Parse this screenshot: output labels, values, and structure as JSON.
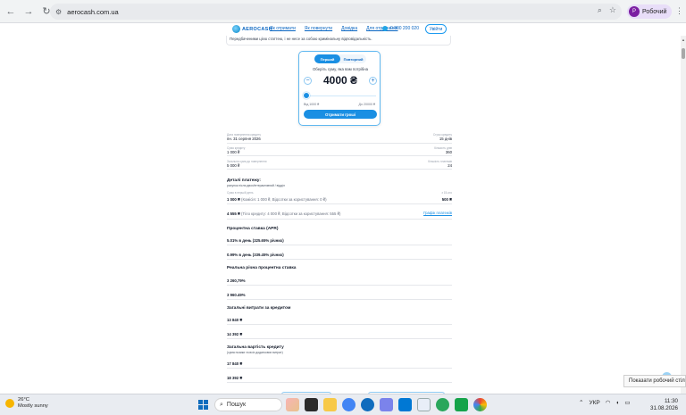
{
  "browser": {
    "url": "aerocash.com.ua",
    "profile_name": "Робочий",
    "profile_initial": "Р"
  },
  "site": {
    "logo_text": "AEROCASH",
    "nav": [
      "Як отримати",
      "Як повернути",
      "Довідка",
      "Для отримання"
    ],
    "phone": "0 800 200 020",
    "login_label": "Увійти"
  },
  "warning_text": "Передбаченими цією статтею, і не несе за собою кримінальну відповідальність.",
  "calculator": {
    "tab_active": "Перший",
    "tab_inactive": "Повторний",
    "prompt": "Оберіть суму, яка вам потрібна",
    "amount": "4000 ₴",
    "minus": "−",
    "plus": "+",
    "slider_fraction": 0.03,
    "range_min": "Від 1000 ₴",
    "range_max": "До 20000 ₴",
    "cta": "Отримати гроші"
  },
  "details": {
    "due_label": "Дата повернення кредиту",
    "due_value": "пн. 31 серпня 2026",
    "term_label": "Строк кредиту",
    "term_value": "15 днів",
    "amount_label": "Сума кредиту",
    "amount_value": "1 000 ₴",
    "days_label": "Кількість днів",
    "days_value": "360",
    "total_label": "Загальна сума до повернення",
    "total_value": "5 000 ₴",
    "count_label": "Кількість платежів",
    "count_value": "24"
  },
  "payment": {
    "title": "Деталі платежу:",
    "subtitle": "рахунок після двох/інтерактивний / відділ",
    "row1_label": "Сума в першій день",
    "row1_value_bold": "1 000 ₴",
    "row1_value_rest": "(Комісія: 1 000 ₴, Відсотки за користування: 0 ₴)",
    "row1_right_label": "з 15-ого",
    "row1_right_value": "500 ₴",
    "row2_value_bold": "4 555 ₴",
    "row2_value_rest": "(Тіло кредиту: 4 000 ₴, Відсотки за користування: 555 ₴)",
    "row2_link": "Графік платежів"
  },
  "rates": {
    "apr_title": "Процентна ставка (APR)",
    "apr_value1": "5.01% в день (325.65% річних)",
    "apr_value2": "0.99% в день (339.45% річних)",
    "real_title": "Реальна річна процентна ставка",
    "real_value1": "3 260,79%",
    "real_value2": "3 960.49%"
  },
  "costs": {
    "title": "Загальні витрати за кредитом",
    "value1": "13 840 ₴",
    "value2": "14 392 ₴"
  },
  "total_cost": {
    "title": "Загальна вартість кредиту",
    "subtitle": "(сума позики та всіх додаткових витрат)",
    "value1": "17 840 ₴",
    "value2": "18 392 ₴"
  },
  "tooltip": "Показати робочий стіл",
  "taskbar": {
    "temperature": "26°C",
    "weather": "Mostly sunny",
    "search_placeholder": "Пошук",
    "language": "УКР",
    "time": "11:30",
    "date": "31.08.2026"
  }
}
